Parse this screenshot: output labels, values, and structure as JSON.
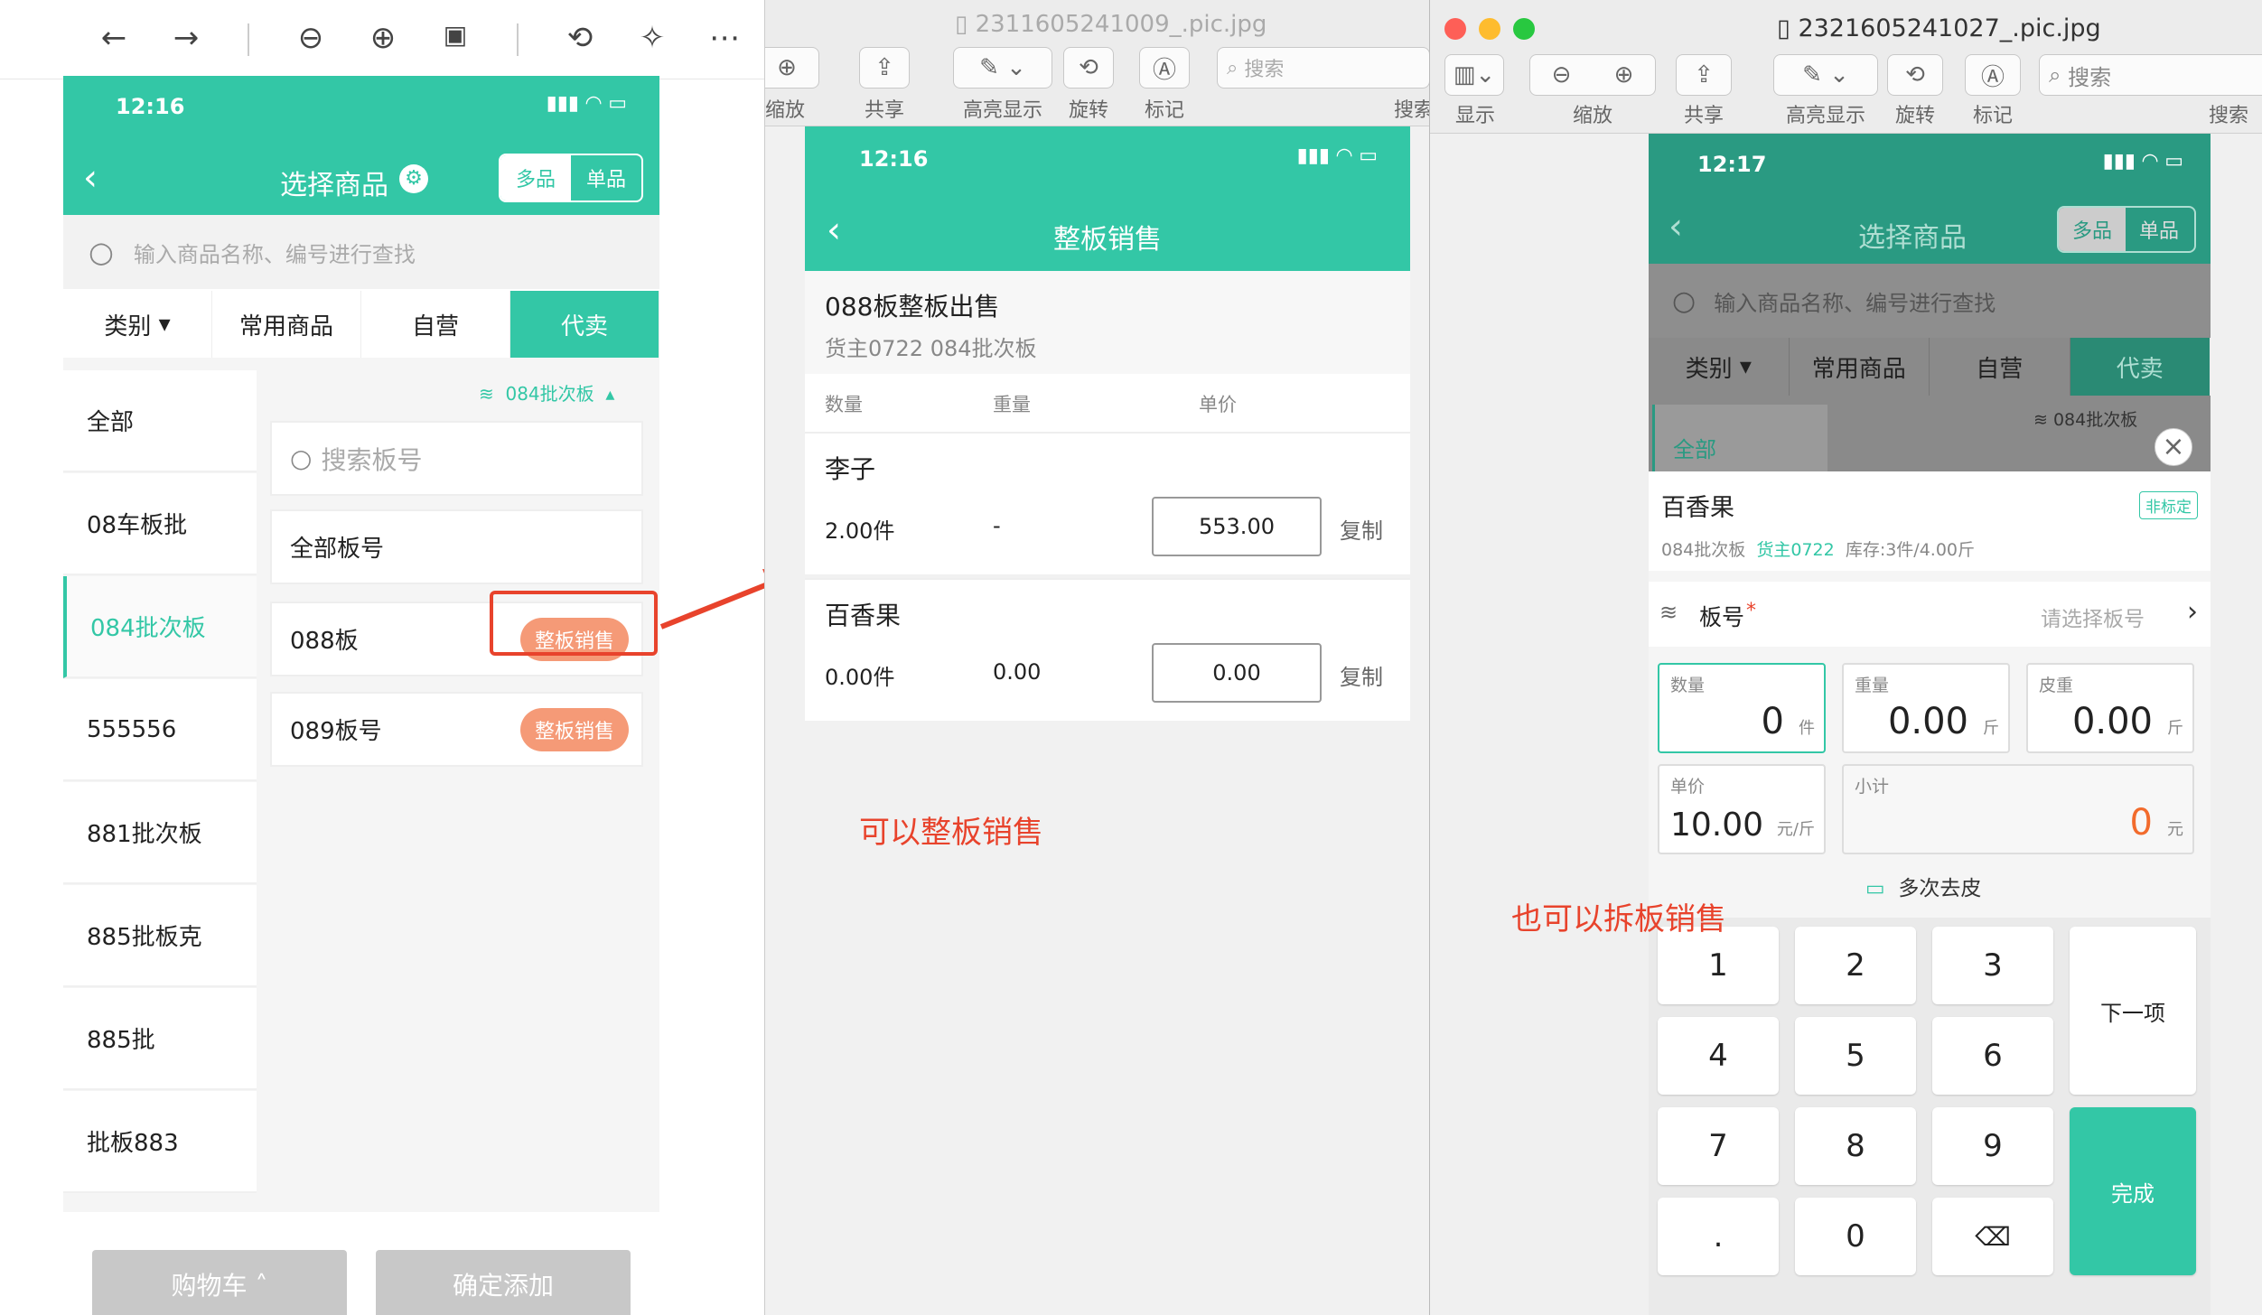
{
  "colors": {
    "teal": "#33c7a6",
    "orange": "#f59a77",
    "red": "#e8432c"
  },
  "win1": {
    "toolbar_icons": [
      "back-arrow",
      "forward-arrow",
      "zoom-out",
      "zoom-in",
      "actual-size",
      "rotate",
      "magic-wand",
      "more"
    ],
    "phone": {
      "time": "12:16",
      "title": "选择商品",
      "seg_multi": "多品",
      "seg_single": "单品",
      "search_placeholder": "输入商品名称、编号进行查找",
      "tabs": [
        "类别",
        "常用商品",
        "自营",
        "代卖"
      ],
      "batch_label": "084批次板",
      "board_search_placeholder": "搜索板号",
      "sidebar": [
        "全部",
        "08车板批",
        "084批次板",
        "555556",
        "881批次板",
        "885批板克",
        "885批",
        "批板883"
      ],
      "boards": [
        "全部板号",
        "088板",
        "089板号"
      ],
      "sell_label": "整板销售",
      "cart": "购物车",
      "confirm": "确定添加"
    }
  },
  "win2": {
    "title": "2311605241009_.pic.jpg",
    "toolbar": [
      "缩放",
      "共享",
      "高亮显示",
      "旋转",
      "标记"
    ],
    "search_placeholder": "搜索",
    "search_label": "搜索",
    "phone": {
      "time": "12:16",
      "title": "整板销售",
      "head_title": "088板整板出售",
      "head_sub": "货主0722 084批次板",
      "col_qty": "数量",
      "col_weight": "重量",
      "col_price": "单价",
      "items": [
        {
          "name": "李子",
          "qty": "2.00件",
          "weight": "-",
          "price": "553.00",
          "copy": "复制"
        },
        {
          "name": "百香果",
          "qty": "0.00件",
          "weight": "0.00",
          "price": "0.00",
          "copy": "复制"
        }
      ]
    },
    "annotation": "可以整板销售"
  },
  "win3": {
    "title": "2321605241027_.pic.jpg",
    "toolbar": [
      "显示",
      "缩放",
      "共享",
      "高亮显示",
      "旋转",
      "标记"
    ],
    "search_placeholder": "搜索",
    "search_label": "搜索",
    "phone": {
      "time": "12:17",
      "title": "选择商品",
      "seg_multi": "多品",
      "seg_single": "单品",
      "search_placeholder": "输入商品名称、编号进行查找",
      "tabs": [
        "类别",
        "常用商品",
        "自营",
        "代卖"
      ],
      "side_first": "全部",
      "batch_label": "084批次板",
      "product": "百香果",
      "tag": "非标定",
      "meta_batch": "084批次板",
      "meta_owner": "货主0722",
      "meta_stock": "库存:3件/4.00斤",
      "board_label": "板号",
      "board_required": "*",
      "board_hint": "请选择板号",
      "fields": [
        {
          "label": "数量",
          "value": "0",
          "unit": "件"
        },
        {
          "label": "重量",
          "value": "0.00",
          "unit": "斤"
        },
        {
          "label": "皮重",
          "value": "0.00",
          "unit": "斤"
        },
        {
          "label": "单价",
          "value": "10.00",
          "unit": "元/斤"
        },
        {
          "label": "小计",
          "value": "0",
          "unit": "元"
        }
      ],
      "multi_tare": "多次去皮",
      "keys": [
        "1",
        "2",
        "3",
        "4",
        "5",
        "6",
        "7",
        "8",
        "9",
        ".",
        "0"
      ],
      "next": "下一项",
      "done": "完成"
    },
    "annotation": "也可以拆板销售"
  }
}
